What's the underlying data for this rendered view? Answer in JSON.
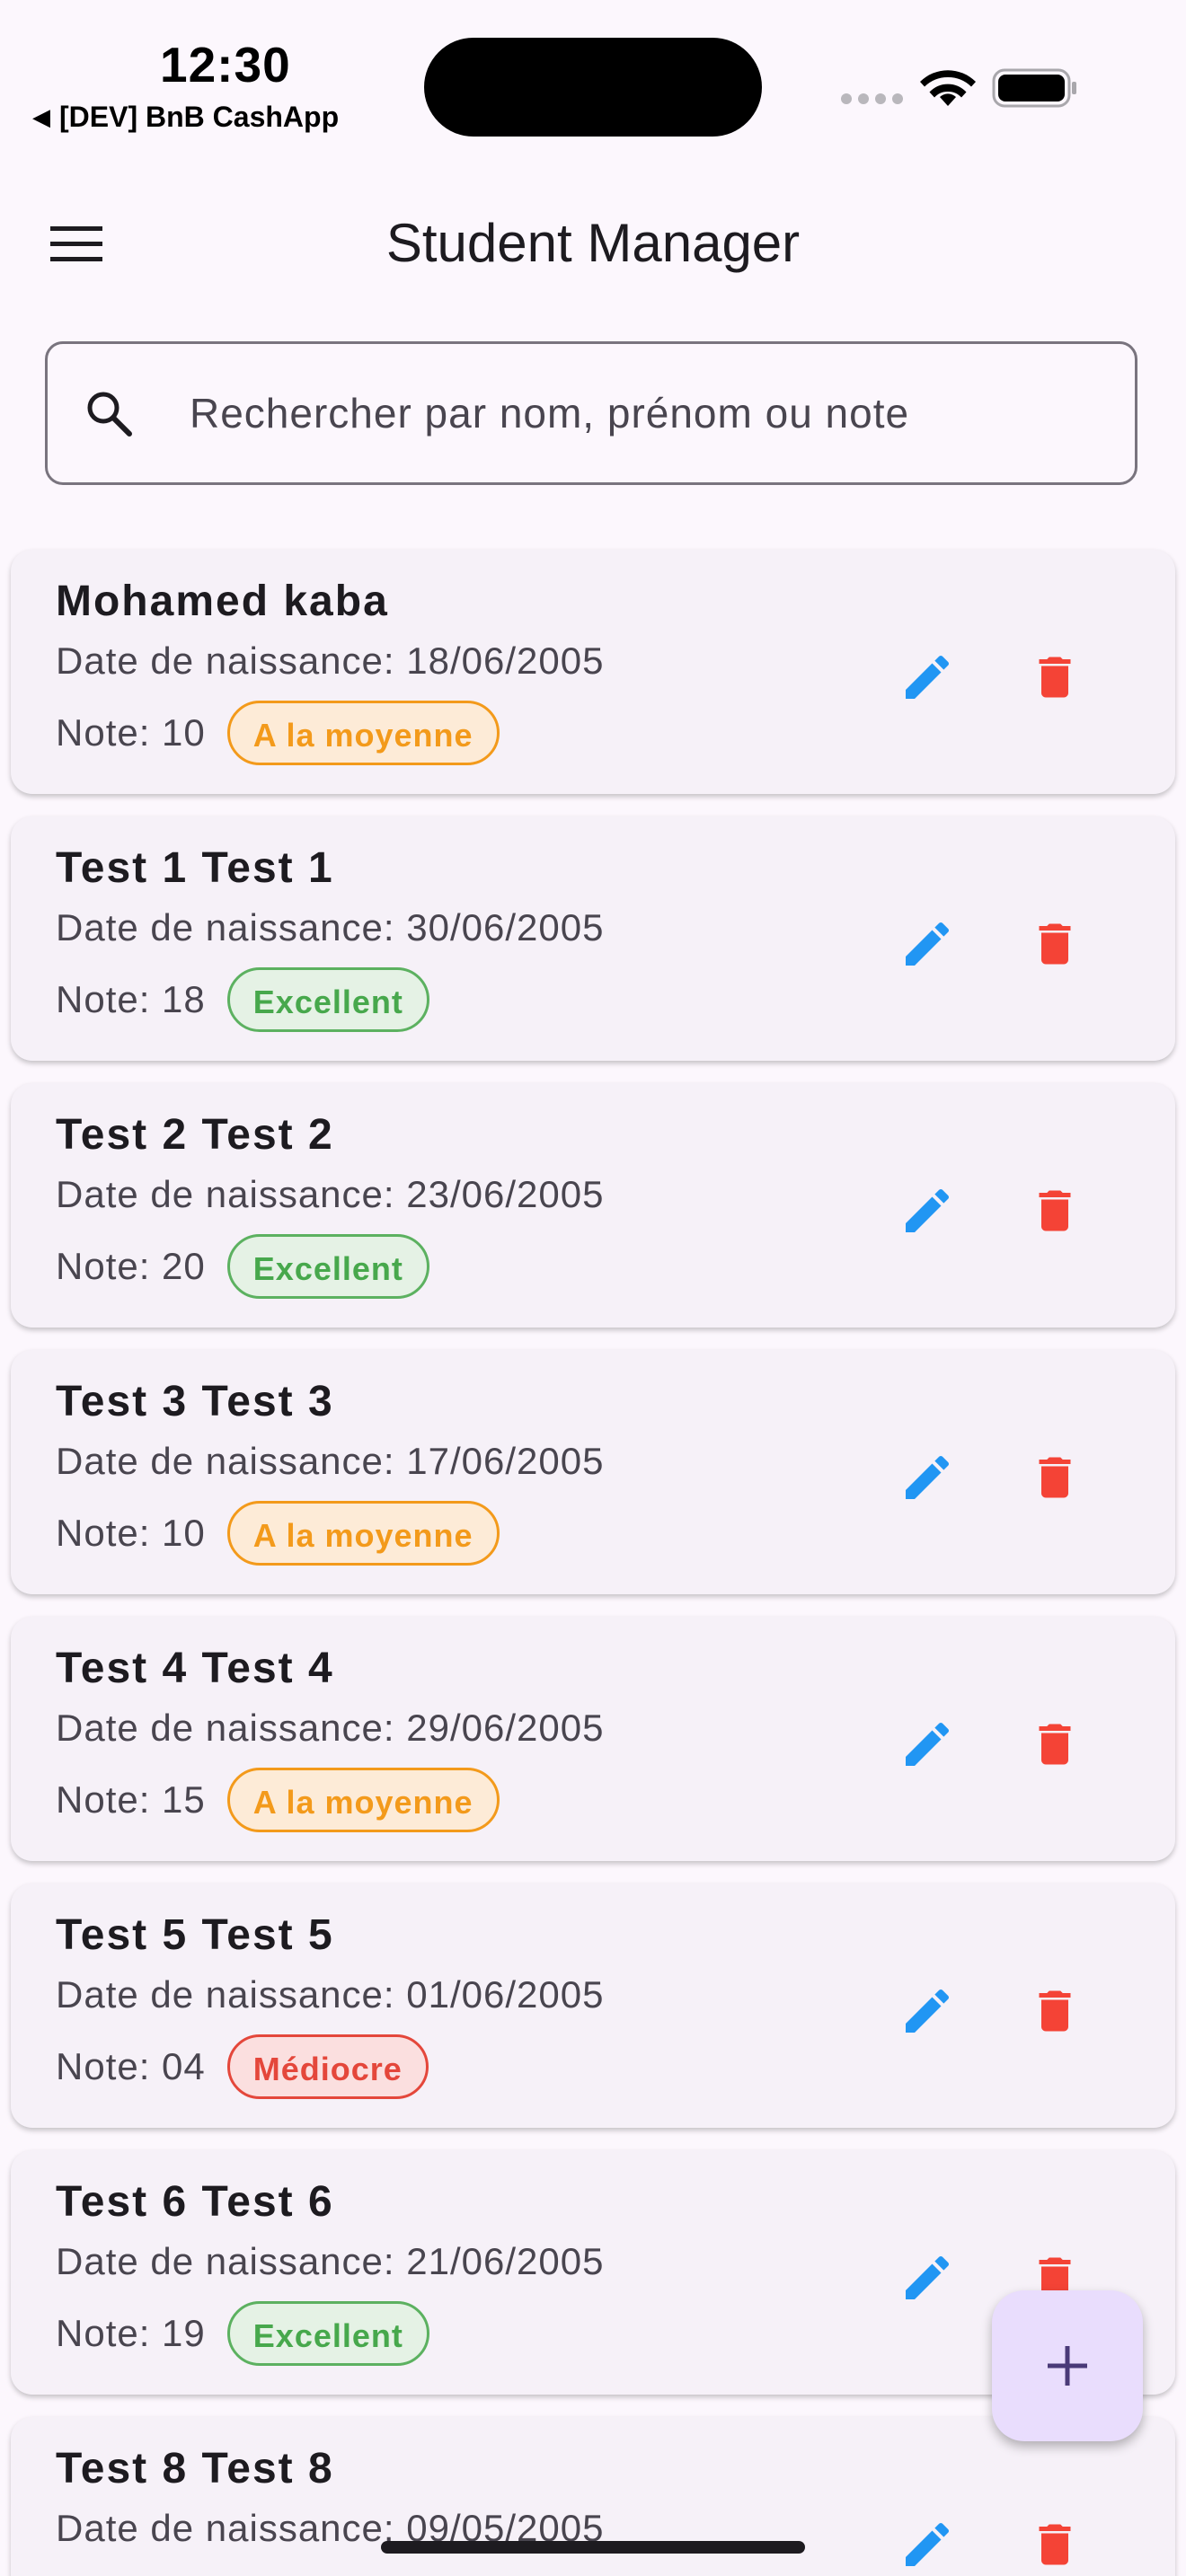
{
  "status_bar": {
    "time": "12:30",
    "back_app": "[DEV] BnB CashApp"
  },
  "app_bar": {
    "title": "Student Manager",
    "menu_icon": "menu-icon"
  },
  "search": {
    "placeholder": "Rechercher par nom, prénom ou note",
    "value": ""
  },
  "colors": {
    "background": "#fcf7fd",
    "card": "#f6f1f8",
    "edit": "#2196f3",
    "delete": "#f44336",
    "badge_orange": "#f39a1b",
    "badge_green": "#47a84c",
    "badge_red": "#e4473b",
    "fab": "#e9ddfd"
  },
  "students": [
    {
      "name": "Mohamed kaba",
      "dob": "Date de naissance: 18/06/2005",
      "note": "Note: 10",
      "badge": "A la moyenne",
      "badge_type": "orange"
    },
    {
      "name": "Test 1 Test 1",
      "dob": "Date de naissance: 30/06/2005",
      "note": "Note: 18",
      "badge": "Excellent",
      "badge_type": "green"
    },
    {
      "name": "Test 2 Test 2",
      "dob": "Date de naissance: 23/06/2005",
      "note": "Note: 20",
      "badge": "Excellent",
      "badge_type": "green"
    },
    {
      "name": "Test 3 Test 3",
      "dob": "Date de naissance: 17/06/2005",
      "note": "Note: 10",
      "badge": "A la moyenne",
      "badge_type": "orange"
    },
    {
      "name": "Test 4 Test 4",
      "dob": "Date de naissance: 29/06/2005",
      "note": "Note: 15",
      "badge": "A la moyenne",
      "badge_type": "orange"
    },
    {
      "name": "Test 5 Test 5",
      "dob": "Date de naissance: 01/06/2005",
      "note": "Note: 04",
      "badge": "Médiocre",
      "badge_type": "red"
    },
    {
      "name": "Test 6 Test 6",
      "dob": "Date de naissance: 21/06/2005",
      "note": "Note: 19",
      "badge": "Excellent",
      "badge_type": "green"
    },
    {
      "name": "Test 8 Test 8",
      "dob": "Date de naissance: 09/05/2005",
      "note": "",
      "badge": "",
      "badge_type": "green"
    }
  ],
  "fab": {
    "icon": "plus-icon"
  }
}
